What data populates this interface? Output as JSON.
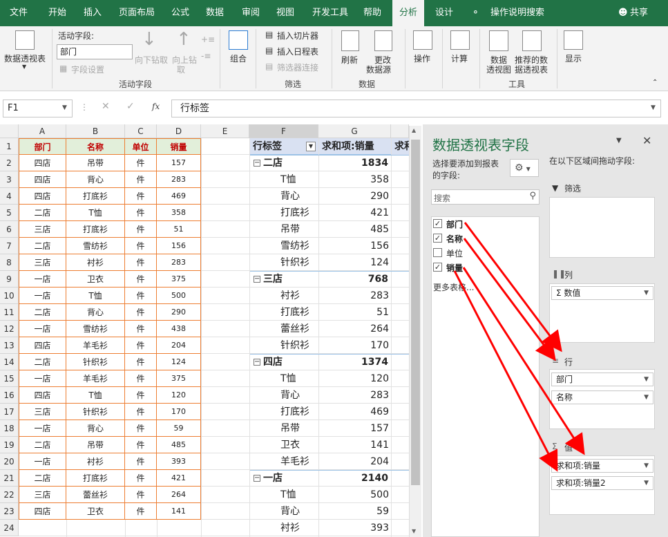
{
  "menu": {
    "tabs": [
      "文件",
      "开始",
      "插入",
      "页面布局",
      "公式",
      "数据",
      "审阅",
      "视图",
      "开发工具",
      "帮助",
      "分析",
      "设计"
    ],
    "search": "操作说明搜索",
    "share": "共享"
  },
  "ribbon": {
    "pivot_button": "数据透视表",
    "active_field_label": "活动字段:",
    "active_field_value": "部门",
    "drill_down": "向下钻取",
    "drill_up_1": "向上钻",
    "drill_up_2": "取",
    "field_settings": "字段设置",
    "group_active_field": "活动字段",
    "group_btn": "组合",
    "insert_slicer": "插入切片器",
    "insert_timeline": "插入日程表",
    "filter_connections": "筛选器连接",
    "group_filter": "筛选",
    "refresh": "刷新",
    "change_source_1": "更改",
    "change_source_2": "数据源",
    "group_data": "数据",
    "actions": "操作",
    "calculations": "计算",
    "pivot_chart_1": "数据",
    "pivot_chart_2": "透视图",
    "recommended_1": "推荐的数",
    "recommended_2": "据透视表",
    "group_tools": "工具",
    "show": "显示"
  },
  "formula": {
    "name_box": "F1",
    "fx_label": "fx",
    "content": "行标签"
  },
  "columns": [
    "A",
    "B",
    "C",
    "D",
    "E",
    "F",
    "G"
  ],
  "rows": [
    "1",
    "2",
    "3",
    "4",
    "5",
    "6",
    "7",
    "8",
    "9",
    "10",
    "11",
    "12",
    "13",
    "14",
    "15",
    "16",
    "17",
    "18",
    "19",
    "20",
    "21",
    "22",
    "23",
    "24"
  ],
  "source_headers": [
    "部门",
    "名称",
    "单位",
    "销量"
  ],
  "source_rows": [
    [
      "四店",
      "吊带",
      "件",
      "157"
    ],
    [
      "四店",
      "背心",
      "件",
      "283"
    ],
    [
      "四店",
      "打底衫",
      "件",
      "469"
    ],
    [
      "二店",
      "T恤",
      "件",
      "358"
    ],
    [
      "三店",
      "打底衫",
      "件",
      "51"
    ],
    [
      "二店",
      "雪纺衫",
      "件",
      "156"
    ],
    [
      "三店",
      "衬衫",
      "件",
      "283"
    ],
    [
      "一店",
      "卫衣",
      "件",
      "375"
    ],
    [
      "一店",
      "T恤",
      "件",
      "500"
    ],
    [
      "二店",
      "背心",
      "件",
      "290"
    ],
    [
      "一店",
      "雪纺衫",
      "件",
      "438"
    ],
    [
      "四店",
      "羊毛衫",
      "件",
      "204"
    ],
    [
      "二店",
      "针织衫",
      "件",
      "124"
    ],
    [
      "一店",
      "羊毛衫",
      "件",
      "375"
    ],
    [
      "四店",
      "T恤",
      "件",
      "120"
    ],
    [
      "三店",
      "针织衫",
      "件",
      "170"
    ],
    [
      "一店",
      "背心",
      "件",
      "59"
    ],
    [
      "二店",
      "吊带",
      "件",
      "485"
    ],
    [
      "一店",
      "衬衫",
      "件",
      "393"
    ],
    [
      "二店",
      "打底衫",
      "件",
      "421"
    ],
    [
      "三店",
      "蕾丝衫",
      "件",
      "264"
    ],
    [
      "四店",
      "卫衣",
      "件",
      "141"
    ]
  ],
  "pivot": {
    "header_label": "行标签",
    "header_value": "求和项:销量",
    "header_extra": "求和",
    "rows": [
      {
        "kind": "group",
        "label": "二店",
        "value": "1834"
      },
      {
        "kind": "item",
        "label": "T恤",
        "value": "358"
      },
      {
        "kind": "item",
        "label": "背心",
        "value": "290"
      },
      {
        "kind": "item",
        "label": "打底衫",
        "value": "421"
      },
      {
        "kind": "item",
        "label": "吊带",
        "value": "485"
      },
      {
        "kind": "item",
        "label": "雪纺衫",
        "value": "156"
      },
      {
        "kind": "item",
        "label": "针织衫",
        "value": "124"
      },
      {
        "kind": "group",
        "label": "三店",
        "value": "768"
      },
      {
        "kind": "item",
        "label": "衬衫",
        "value": "283"
      },
      {
        "kind": "item",
        "label": "打底衫",
        "value": "51"
      },
      {
        "kind": "item",
        "label": "蕾丝衫",
        "value": "264"
      },
      {
        "kind": "item",
        "label": "针织衫",
        "value": "170"
      },
      {
        "kind": "group",
        "label": "四店",
        "value": "1374"
      },
      {
        "kind": "item",
        "label": "T恤",
        "value": "120"
      },
      {
        "kind": "item",
        "label": "背心",
        "value": "283"
      },
      {
        "kind": "item",
        "label": "打底衫",
        "value": "469"
      },
      {
        "kind": "item",
        "label": "吊带",
        "value": "157"
      },
      {
        "kind": "item",
        "label": "卫衣",
        "value": "141"
      },
      {
        "kind": "item",
        "label": "羊毛衫",
        "value": "204"
      },
      {
        "kind": "group",
        "label": "一店",
        "value": "2140"
      },
      {
        "kind": "item",
        "label": "T恤",
        "value": "500"
      },
      {
        "kind": "item",
        "label": "背心",
        "value": "59"
      },
      {
        "kind": "item",
        "label": "衬衫",
        "value": "393"
      }
    ]
  },
  "pane": {
    "title": "数据透视表字段",
    "choose_fields_1": "选择要添加到报表",
    "choose_fields_2": "的字段:",
    "search_placeholder": "搜索",
    "fields": [
      {
        "label": "部门",
        "checked": true
      },
      {
        "label": "名称",
        "checked": true
      },
      {
        "label": "单位",
        "checked": false
      },
      {
        "label": "销量",
        "checked": true
      }
    ],
    "more_tables": "更多表格...",
    "drag_hint": "在以下区域间拖动字段:",
    "filter_area": "筛选",
    "columns_area": "列",
    "columns_items": [
      "Σ 数值"
    ],
    "rows_area": "行",
    "rows_items": [
      "部门",
      "名称"
    ],
    "values_area": "值",
    "values_items": [
      "求和项:销量",
      "求和项:销量2"
    ]
  },
  "colors": {
    "excel_green": "#217346",
    "pane_title": "#217346",
    "header_fill": "#e2efda",
    "header_text": "#c00000",
    "border_orange": "#ed7d31",
    "pivot_header": "#d9e1f2",
    "arrow_red": "#ff0000"
  }
}
